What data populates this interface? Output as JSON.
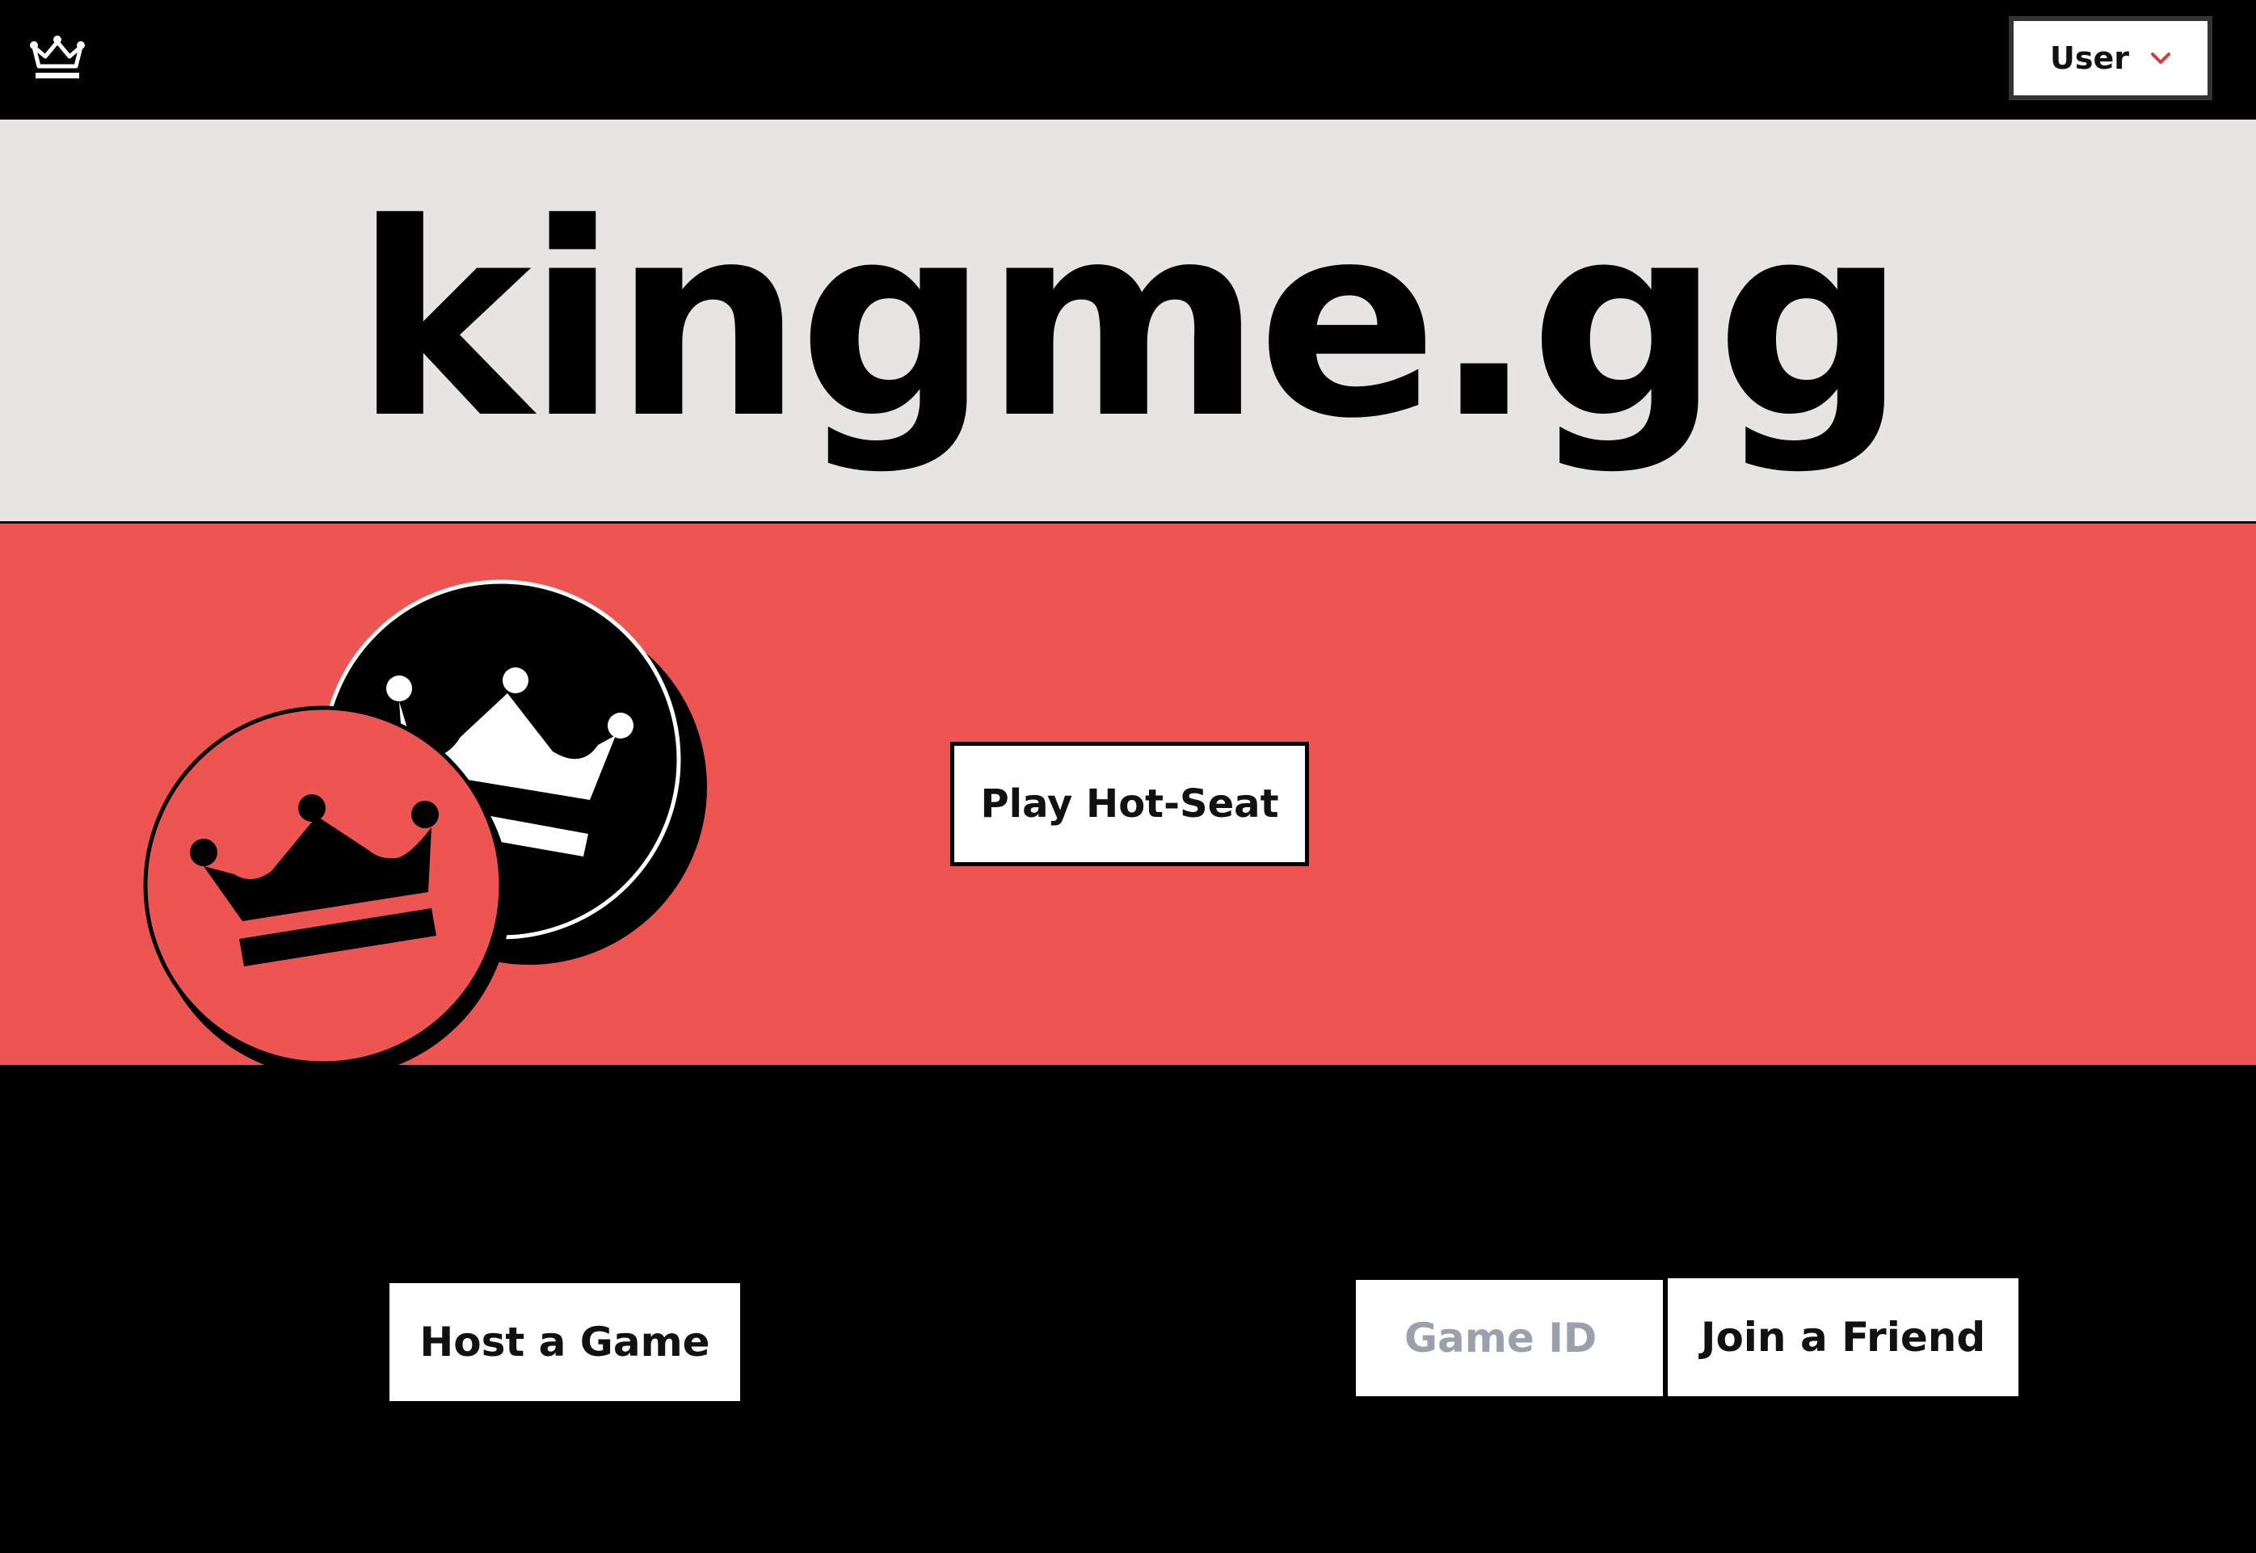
{
  "app": {
    "logo_icon": "crown-icon"
  },
  "header": {
    "user_menu_label": "User",
    "user_menu_icon": "chevron-down-icon"
  },
  "hero": {
    "title": "kingme.gg",
    "play_hotseat_label": "Play Hot-Seat",
    "piece_icons": [
      "crown-icon",
      "crown-icon"
    ]
  },
  "lobby": {
    "host_label": "Host a Game",
    "game_id_placeholder": "Game ID",
    "game_id_value": "",
    "join_label": "Join a Friend"
  },
  "colors": {
    "accent_red": "#ec5552",
    "title_band_grey": "#e6e5e3",
    "dark": "#000000",
    "placeholder_grey": "#9aa1ac",
    "chevron_red": "#d83a3a"
  }
}
